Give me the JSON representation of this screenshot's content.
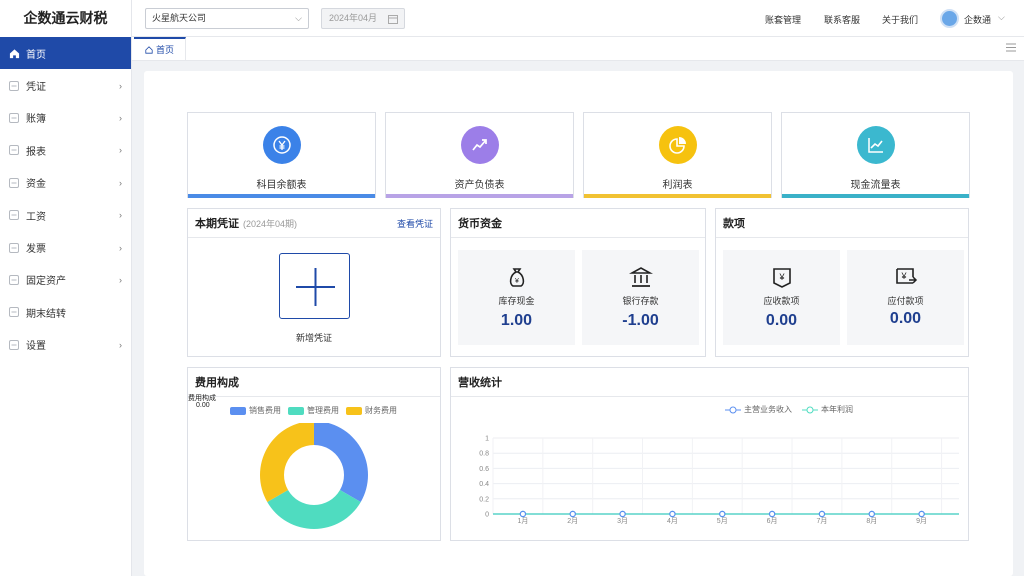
{
  "app": {
    "title": "企数通云财税"
  },
  "sidebar": {
    "items": [
      {
        "label": "首页",
        "icon": "home-icon",
        "active": true,
        "chevron": false
      },
      {
        "label": "凭证",
        "icon": "voucher-icon",
        "chevron": true
      },
      {
        "label": "账簿",
        "icon": "ledger-icon",
        "chevron": true
      },
      {
        "label": "报表",
        "icon": "report-icon",
        "chevron": true
      },
      {
        "label": "资金",
        "icon": "fund-icon",
        "chevron": true
      },
      {
        "label": "工资",
        "icon": "salary-icon",
        "chevron": true
      },
      {
        "label": "发票",
        "icon": "invoice-icon",
        "chevron": true
      },
      {
        "label": "固定资产",
        "icon": "asset-icon",
        "chevron": true
      },
      {
        "label": "期末结转",
        "icon": "closing-icon",
        "chevron": false
      },
      {
        "label": "设置",
        "icon": "settings-icon",
        "chevron": true
      }
    ]
  },
  "header": {
    "company": "火星航天公司",
    "period": "2024年04月",
    "links": [
      "账套管理",
      "联系客服",
      "关于我们"
    ],
    "user": "企数通"
  },
  "tabs": [
    {
      "label": "首页"
    }
  ],
  "quick": [
    {
      "label": "科目余额表",
      "color": "#3b82e8",
      "bar": "#4a8be6",
      "icon": "yuan-icon"
    },
    {
      "label": "资产负债表",
      "color": "#9c7ee8",
      "bar": "#b8a3e6",
      "icon": "trend-icon"
    },
    {
      "label": "利润表",
      "color": "#f6c20f",
      "bar": "#f1c232",
      "icon": "pie-icon"
    },
    {
      "label": "现金流量表",
      "color": "#3bb8cf",
      "bar": "#3ab1c8",
      "icon": "line-chart-icon"
    }
  ],
  "voucher": {
    "title": "本期凭证",
    "period": "(2024年04期)",
    "link": "查看凭证",
    "add": "新增凭证"
  },
  "money": {
    "title": "货币资金",
    "cash_label": "库存现金",
    "cash": "1.00",
    "bank_label": "银行存款",
    "bank": "-1.00"
  },
  "funds": {
    "title": "款项",
    "recv_label": "应收款项",
    "recv": "0.00",
    "pay_label": "应付款项",
    "pay": "0.00"
  },
  "expense": {
    "title": "费用构成",
    "chart_data": {
      "type": "pie",
      "title": "费用构成",
      "subtitle": "0.00",
      "categories": [
        "销售费用",
        "管理费用",
        "财务费用"
      ],
      "colors": [
        "#5b8ff0",
        "#4fdcc0",
        "#f7c21a"
      ],
      "values": [
        0.0,
        0.0,
        0.0
      ],
      "display_fractions": [
        0.3333,
        0.3333,
        0.3333
      ]
    }
  },
  "revenue": {
    "title": "营收统计",
    "chart_data": {
      "type": "line",
      "categories": [
        "1月",
        "2月",
        "3月",
        "4月",
        "5月",
        "6月",
        "7月",
        "8月",
        "9月"
      ],
      "series": [
        {
          "name": "主营业务收入",
          "color": "#5b8ff0",
          "values": [
            0,
            0,
            0,
            0,
            0,
            0,
            0,
            0,
            0
          ]
        },
        {
          "name": "本年利润",
          "color": "#4fdcc0",
          "values": [
            0,
            0,
            0,
            0,
            0,
            0,
            0,
            0,
            0
          ]
        }
      ],
      "y_ticks": [
        "0",
        "0.2",
        "0.4",
        "0.6",
        "0.8",
        "1"
      ],
      "ylim": [
        0,
        1
      ]
    }
  }
}
